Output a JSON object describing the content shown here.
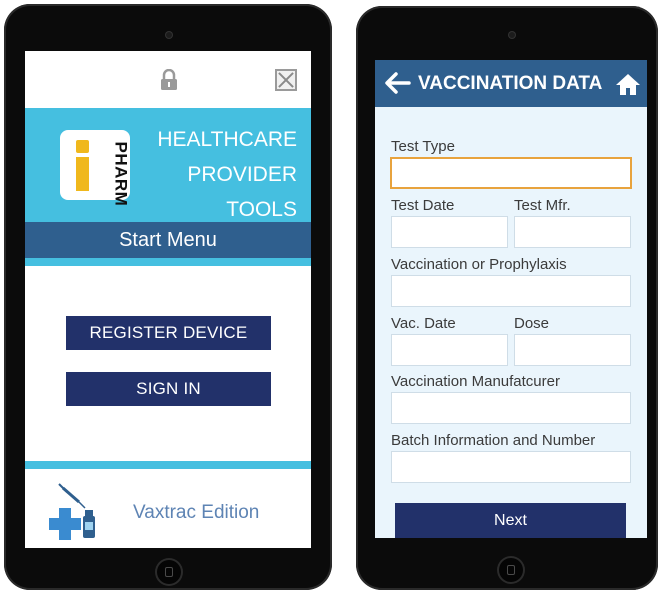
{
  "left_screen": {
    "banner_title_lines": [
      "HEALTHCARE",
      "PROVIDER",
      "TOOLS"
    ],
    "logo_text": "PHARM",
    "start_menu": "Start Menu",
    "register_button": "REGISTER DEVICE",
    "sign_in_button": "SIGN IN",
    "edition": "Vaxtrac Edition",
    "icons": [
      "lock-icon",
      "close-icon",
      "vaccine-kit-icon"
    ],
    "colors": {
      "banner": "#45bfe0",
      "start_bar": "#2f5f8e",
      "button": "#22316a",
      "logo_i": "#f0b81c"
    }
  },
  "right_screen": {
    "title": "VACCINATION DATA",
    "icons": [
      "back-arrow-icon",
      "home-icon"
    ],
    "labels": {
      "test_type": "Test Type",
      "test_date": "Test Date",
      "test_mfr": "Test Mfr.",
      "vaccination": "Vaccination or Prophylaxis",
      "vac_date": "Vac. Date",
      "dose": "Dose",
      "manufacturer": "Vaccination Manufatcurer",
      "batch": "Batch Information and Number"
    },
    "next_button": "Next",
    "colors": {
      "appbar": "#2f5f8e",
      "background": "#eaf5fc",
      "focus_border": "#e8a33d",
      "button": "#22316a"
    }
  }
}
